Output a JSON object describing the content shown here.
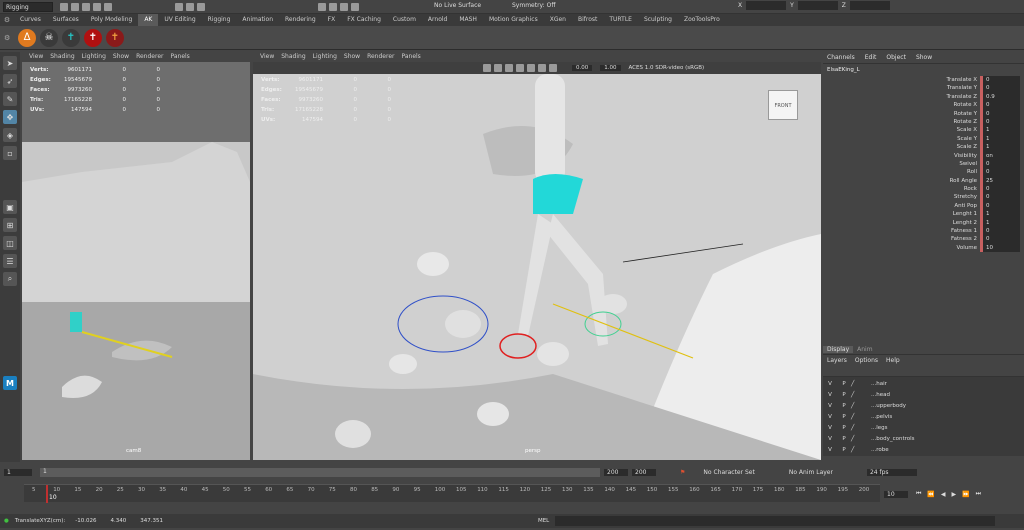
{
  "topbar": {
    "mode": "Rigging",
    "live_surface": "No Live Surface",
    "symmetry": "Symmetry: Off",
    "xyz": [
      "X",
      "Y",
      "Z"
    ]
  },
  "shelf_tabs": [
    "Curves",
    "Surfaces",
    "Poly Modeling",
    "AK",
    "UV Editing",
    "Rigging",
    "Animation",
    "Rendering",
    "FX",
    "FX Caching",
    "Custom",
    "Arnold",
    "MASH",
    "Motion Graphics",
    "XGen",
    "Bifrost",
    "TURTLE",
    "Sculpting",
    "ZooToolsPro"
  ],
  "active_shelf_tab": "AK",
  "panel_menus": [
    "View",
    "Shading",
    "Lighting",
    "Show",
    "Renderer",
    "Panels"
  ],
  "hud": {
    "rows": [
      {
        "label": "Verts:",
        "a": "9601171",
        "b": "0",
        "c": "0"
      },
      {
        "label": "Edges:",
        "a": "19545679",
        "b": "0",
        "c": "0"
      },
      {
        "label": "Faces:",
        "a": "9973260",
        "b": "0",
        "c": "0"
      },
      {
        "label": "Tris:",
        "a": "17165228",
        "b": "0",
        "c": "0"
      },
      {
        "label": "UVs:",
        "a": "147594",
        "b": "0",
        "c": "0"
      }
    ]
  },
  "left_view": {
    "camera": "cam8"
  },
  "main_view": {
    "camera": "persp",
    "gamma_a": "0.00",
    "gamma_b": "1.00",
    "colorspace": "ACES 1.0 SDR-video (sRGB)",
    "cube_label": "FRONT"
  },
  "channel_box": {
    "menus": [
      "Channels",
      "Edit",
      "Object",
      "Show"
    ],
    "object": "ElsaEKing_L",
    "attrs": [
      {
        "n": "Translate X",
        "v": "0"
      },
      {
        "n": "Translate Y",
        "v": "0"
      },
      {
        "n": "Translate Z",
        "v": "0.9"
      },
      {
        "n": "Rotate X",
        "v": "0"
      },
      {
        "n": "Rotate Y",
        "v": "0"
      },
      {
        "n": "Rotate Z",
        "v": "0"
      },
      {
        "n": "Scale X",
        "v": "1"
      },
      {
        "n": "Scale Y",
        "v": "1"
      },
      {
        "n": "Scale Z",
        "v": "1"
      },
      {
        "n": "Visibility",
        "v": "on"
      },
      {
        "n": "Swivel",
        "v": "0"
      },
      {
        "n": "Roll",
        "v": "0"
      },
      {
        "n": "Roll Angle",
        "v": "25"
      },
      {
        "n": "Rock",
        "v": "0"
      },
      {
        "n": "Stretchy",
        "v": "0"
      },
      {
        "n": "Anti Pop",
        "v": "0"
      },
      {
        "n": "Lenght 1",
        "v": "1"
      },
      {
        "n": "Lenght 2",
        "v": "1"
      },
      {
        "n": "Fatness 1",
        "v": "0"
      },
      {
        "n": "Fatness 2",
        "v": "0"
      },
      {
        "n": "Volume",
        "v": "10"
      }
    ]
  },
  "layer_editor": {
    "tabs": [
      "Display",
      "Anim"
    ],
    "menus": [
      "Layers",
      "Options",
      "Help"
    ],
    "layers": [
      "...hair",
      "...head",
      "...upperbody",
      "...pelvis",
      "...legs",
      "...body_controls",
      "...robe"
    ],
    "v": "V",
    "p": "P"
  },
  "timeline": {
    "start": "1",
    "range_start": "1",
    "range_end": "200",
    "end": "200",
    "current": "10",
    "fps": "24 fps",
    "char_set": "No Character Set",
    "anim_layer": "No Anim Layer",
    "ticks": [
      "5",
      "10",
      "15",
      "20",
      "25",
      "30",
      "35",
      "40",
      "45",
      "50",
      "55",
      "60",
      "65",
      "70",
      "75",
      "80",
      "85",
      "90",
      "95",
      "100",
      "105",
      "110",
      "115",
      "120",
      "125",
      "130",
      "135",
      "140",
      "145",
      "150",
      "155",
      "160",
      "165",
      "170",
      "175",
      "180",
      "185",
      "190",
      "195",
      "200"
    ]
  },
  "status": {
    "label": "TranslateXYZ(cm):",
    "x": "-10.026",
    "y": "4.340",
    "z": "347.351",
    "mel": "MEL"
  }
}
